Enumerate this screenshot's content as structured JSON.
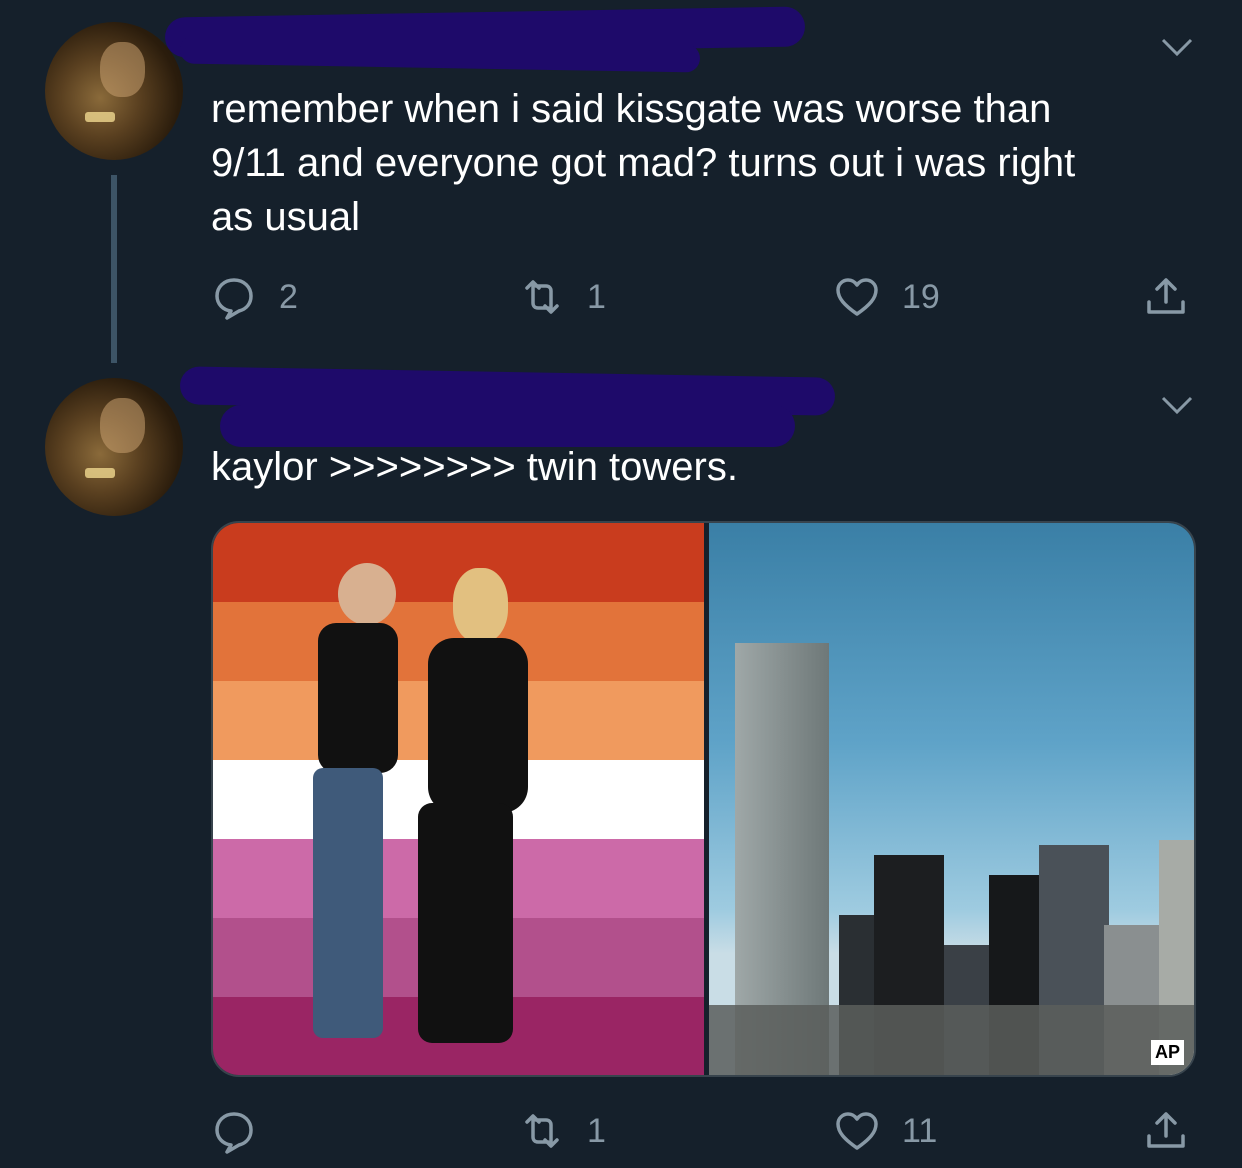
{
  "tweets": [
    {
      "text": "remember when i said kissgate was worse than\n9/11 and everyone got mad? turns out i was right\nas usual",
      "reply_count": "2",
      "retweet_count": "1",
      "like_count": "19"
    },
    {
      "text": "kaylor >>>>>>>> twin towers.",
      "reply_count": "",
      "retweet_count": "1",
      "like_count": "11"
    }
  ],
  "media": {
    "watermark": "AP",
    "flag_colors": [
      "#c93c1e",
      "#e2733a",
      "#f09a5e",
      "#ffffff",
      "#cc6aa8",
      "#b2508c",
      "#9a2564"
    ]
  },
  "icons": [
    "reply-icon",
    "retweet-icon",
    "like-icon",
    "share-icon",
    "chevron-down-icon"
  ]
}
